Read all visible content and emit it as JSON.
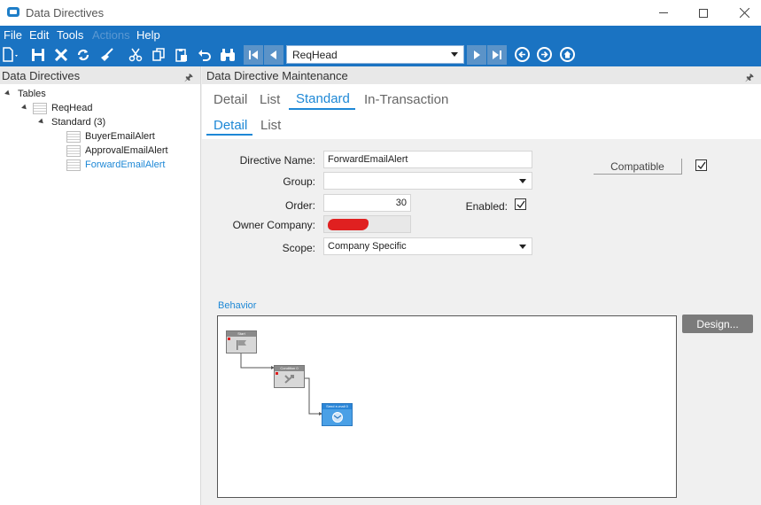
{
  "window": {
    "title": "Data Directives"
  },
  "menu": {
    "items": [
      "File",
      "Edit",
      "Tools",
      "Actions",
      "Help"
    ]
  },
  "toolbar": {
    "nav_value": "ReqHead"
  },
  "tree_panel": {
    "header": "Data Directives",
    "nodes": {
      "tables": "Tables",
      "reqhead": "ReqHead",
      "standard": "Standard (3)",
      "item1": "BuyerEmailAlert",
      "item2": "ApprovalEmailAlert",
      "item3": "ForwardEmailAlert"
    }
  },
  "main_panel": {
    "header": "Data Directive Maintenance",
    "tabs_top": [
      "Detail",
      "List",
      "Standard",
      "In-Transaction"
    ],
    "tabs_sub": [
      "Detail",
      "List"
    ],
    "form": {
      "directive_name_label": "Directive Name:",
      "directive_name_value": "ForwardEmailAlert",
      "group_label": "Group:",
      "group_value": "",
      "order_label": "Order:",
      "order_value": "30",
      "enabled_label": "Enabled:",
      "owner_company_label": "Owner Company:",
      "scope_label": "Scope:",
      "scope_value": "Company Specific",
      "compatible_label": "Compatible"
    },
    "behavior": {
      "label": "Behavior",
      "design_button": "Design...",
      "nodes": [
        "Start",
        "Condition 0",
        "Send e-mail 0"
      ]
    }
  },
  "colors": {
    "accent": "#1a73c2",
    "active_tab": "#1e88d6"
  }
}
